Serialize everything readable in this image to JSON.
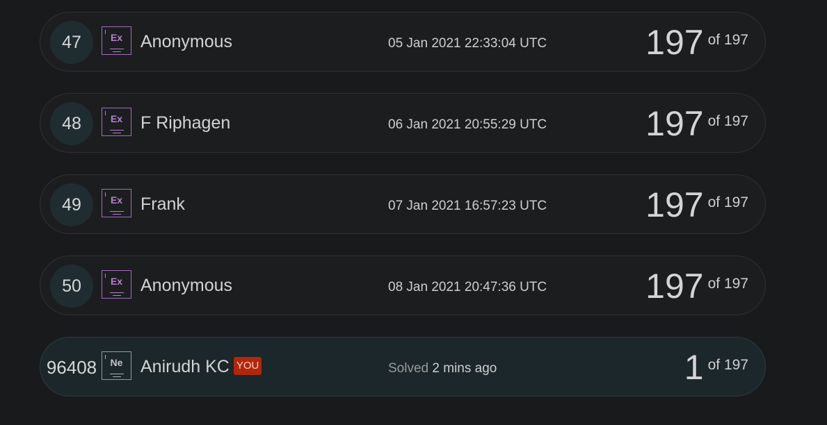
{
  "rows": [
    {
      "rank": "47",
      "element": "Ex",
      "name": "Anonymous",
      "time": "05 Jan 2021 22:33:04 UTC",
      "score": "197",
      "of": "of 197"
    },
    {
      "rank": "48",
      "element": "Ex",
      "name": "F Riphagen",
      "time": "06 Jan 2021 20:55:29 UTC",
      "score": "197",
      "of": "of 197"
    },
    {
      "rank": "49",
      "element": "Ex",
      "name": "Frank",
      "time": "07 Jan 2021 16:57:23 UTC",
      "score": "197",
      "of": "of 197"
    },
    {
      "rank": "50",
      "element": "Ex",
      "name": "Anonymous",
      "time": "08 Jan 2021 20:47:36 UTC",
      "score": "197",
      "of": "of 197"
    }
  ],
  "me": {
    "rank": "96408",
    "element": "Ne",
    "name": "Anirudh KC",
    "you_label": "YOU",
    "time_prefix": "Solved",
    "time": "2 mins ago",
    "score": "1",
    "of": "of 197"
  },
  "colors": {
    "background": "#191a1c",
    "expert_badge": "#a46cc0",
    "novice_badge": "#9a9a9a",
    "you_badge": "#b2260c",
    "highlight_row": "#1b272b"
  }
}
